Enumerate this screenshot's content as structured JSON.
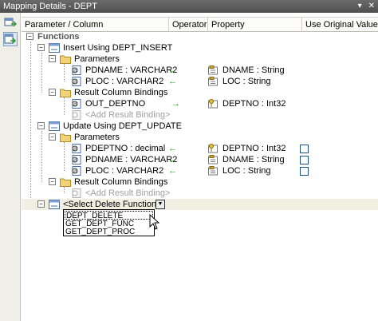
{
  "window": {
    "title": "Mapping Details - DEPT",
    "pin_glyph": "▾",
    "close_glyph": "✕"
  },
  "toolbar": {
    "items": [
      "table-mapping",
      "function-mapping"
    ]
  },
  "columns": [
    "Parameter / Column",
    "Operator",
    "Property",
    "Use Original Value"
  ],
  "tree": {
    "functions_label": "Functions",
    "insert": {
      "label": "Insert Using DEPT_INSERT",
      "params_label": "Parameters",
      "params": [
        {
          "name": "PDNAME : VARCHAR2",
          "arrow": "←",
          "property": "DNAME : String"
        },
        {
          "name": "PLOC : VARCHAR2",
          "arrow": "←",
          "property": "LOC : String"
        }
      ],
      "results_label": "Result Column Bindings",
      "results": [
        {
          "name": "OUT_DEPTNO",
          "arrow": "→",
          "property": "DEPTNO : Int32"
        }
      ],
      "add_binding": "<Add Result Binding>"
    },
    "update": {
      "label": "Update Using DEPT_UPDATE",
      "params_label": "Parameters",
      "params": [
        {
          "name": "PDEPTNO : decimal",
          "arrow": "←",
          "property": "DEPTNO : Int32"
        },
        {
          "name": "PDNAME : VARCHAR2",
          "arrow": "←",
          "property": "DNAME : String"
        },
        {
          "name": "PLOC : VARCHAR2",
          "arrow": "←",
          "property": "LOC : String"
        }
      ],
      "results_label": "Result Column Bindings",
      "add_binding": "<Add Result Binding>"
    },
    "delete": {
      "label": "<Select Delete Function>",
      "options": [
        "DEPT_DELETE",
        "GET_DEPT_FUNC",
        "GET_DEPT_PROC"
      ]
    }
  },
  "colors": {
    "arrow": "#2e9b2e",
    "selected_row": "#f1efe2",
    "title_bar": "#5a5a5a"
  }
}
